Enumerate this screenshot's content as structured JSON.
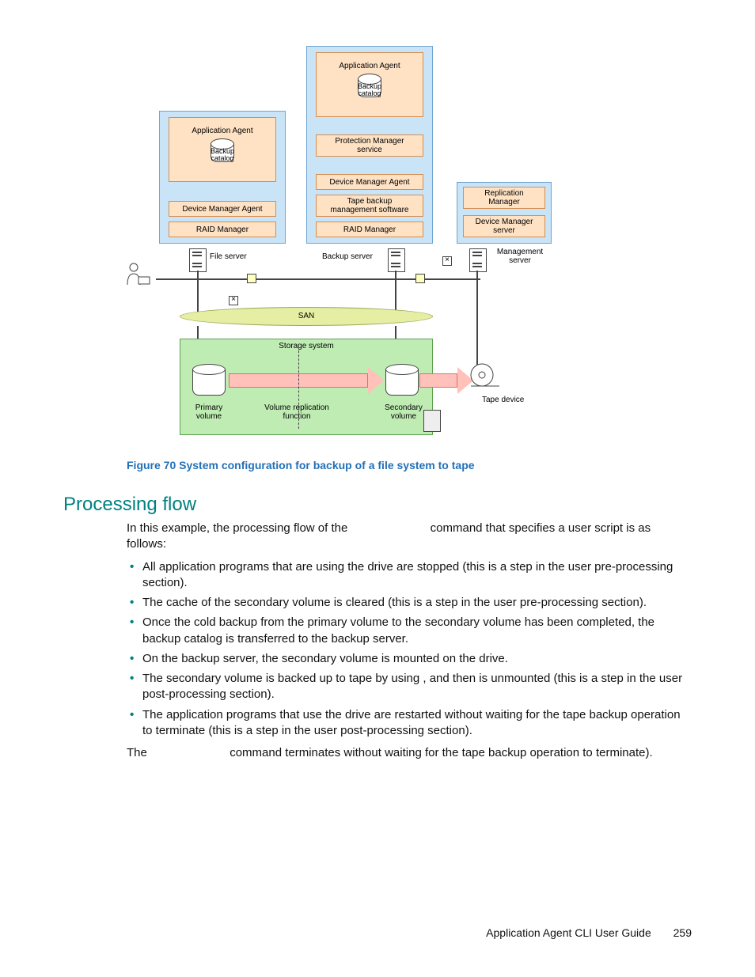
{
  "diagram": {
    "col1": {
      "box_app_agent": "Application Agent",
      "cyl_label_line1": "Backup",
      "cyl_label_line2": "catalog",
      "box_dev_mgr_agent": "Device Manager Agent",
      "box_raid_mgr": "RAID Manager",
      "server_label": "File server"
    },
    "col2": {
      "box_app_agent": "Application Agent",
      "cyl_label_line1": "Backup",
      "cyl_label_line2": "catalog",
      "box_pm_service_line1": "Protection Manager",
      "box_pm_service_line2": "service",
      "box_dev_mgr_agent": "Device Manager Agent",
      "box_tape_sw_line1": "Tape backup",
      "box_tape_sw_line2": "management software",
      "box_raid_mgr": "RAID Manager",
      "server_label": "Backup server"
    },
    "col3": {
      "box_repl_mgr_line1": "Replication",
      "box_repl_mgr_line2": "Manager",
      "box_dm_server_line1": "Device Manager",
      "box_dm_server_line2": "server",
      "server_label_line1": "Management",
      "server_label_line2": "server"
    },
    "san": "SAN",
    "storage_system": "Storage system",
    "primary_volume_line1": "Primary",
    "primary_volume_line2": "volume",
    "vol_repl_fn_line1": "Volume replication",
    "vol_repl_fn_line2": "function",
    "secondary_volume_line1": "Secondary",
    "secondary_volume_line2": "volume",
    "tape_device": "Tape device"
  },
  "figure_caption": "Figure 70 System configuration for backup of a file system to tape",
  "section_heading": "Processing flow",
  "intro_before": "In this example, the processing flow of the ",
  "intro_after": " command that specifies a user script is as follows:",
  "bullets": [
    "All application programs that are using the   drive are stopped (this is a step in the user pre-processing section).",
    "The cache of the secondary volume is cleared (this is a step in the user pre-processing section).",
    "Once the cold backup from the primary volume to the secondary volume has been completed, the backup catalog is transferred to the backup server.",
    "On the backup server, the secondary volume is mounted on the   drive.",
    "The secondary volume is backed up to tape by using              , and then is unmounted (this is a step in the user post-processing section).",
    "The application programs that use the   drive are restarted without waiting for the tape backup operation to terminate (this is a step in the user post-processing section)."
  ],
  "closing_before": "The ",
  "closing_after": " command terminates without waiting for the tape backup operation to terminate).",
  "footer_title": "Application Agent CLI User Guide",
  "page_number": "259"
}
